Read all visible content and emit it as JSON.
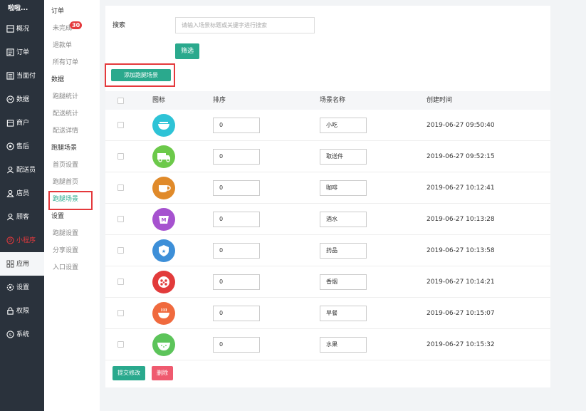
{
  "sidebar": {
    "logo": "啦啦...",
    "items": [
      {
        "label": "概况",
        "icon": "overview-icon"
      },
      {
        "label": "订单",
        "icon": "order-icon"
      },
      {
        "label": "当面付",
        "icon": "pay-icon"
      },
      {
        "label": "数据",
        "icon": "data-icon"
      },
      {
        "label": "商户",
        "icon": "shop-icon"
      },
      {
        "label": "售后",
        "icon": "aftersale-icon"
      },
      {
        "label": "配送员",
        "icon": "courier-icon"
      },
      {
        "label": "店员",
        "icon": "clerk-icon"
      },
      {
        "label": "顾客",
        "icon": "customer-icon"
      },
      {
        "label": "小程序",
        "icon": "miniapp-icon"
      },
      {
        "label": "应用",
        "icon": "apps-icon"
      },
      {
        "label": "设置",
        "icon": "settings-icon"
      },
      {
        "label": "权限",
        "icon": "lock-icon"
      },
      {
        "label": "系统",
        "icon": "system-icon"
      }
    ]
  },
  "subnav": {
    "group_order": "订单",
    "unfinished": "未完成",
    "badge": "30",
    "refund": "退款单",
    "all_orders": "所有订单",
    "group_data": "数据",
    "errand_stats": "跑腿统计",
    "delivery_stats": "配送统计",
    "delivery_detail": "配送详情",
    "group_scene": "跑腿场景",
    "home_settings": "首页设置",
    "errand_home": "跑腿首页",
    "errand_scene": "跑腿场景",
    "group_settings": "设置",
    "errand_settings": "跑腿设置",
    "share_settings": "分享设置",
    "entry_settings": "入口设置"
  },
  "search": {
    "label": "搜索",
    "placeholder": "请输入场景标题或关键字进行搜索",
    "filter_label": "筛选"
  },
  "toolbar": {
    "add_label": "添加跑腿场景"
  },
  "table": {
    "headers": {
      "icon": "图标",
      "sort": "排序",
      "name": "场景名称",
      "created": "创建时间"
    },
    "rows": [
      {
        "sort": "0",
        "name": "小吃",
        "created": "2019-06-27 09:50:40",
        "icon": "snack-bowl-icon",
        "color": "#2ec3d6"
      },
      {
        "sort": "0",
        "name": "取送件",
        "created": "2019-06-27 09:52:15",
        "icon": "delivery-truck-icon",
        "color": "#6cc94a"
      },
      {
        "sort": "0",
        "name": "咖啡",
        "created": "2019-06-27 10:12:41",
        "icon": "coffee-cup-icon",
        "color": "#e08a2a"
      },
      {
        "sort": "0",
        "name": "酒水",
        "created": "2019-06-27 10:13:28",
        "icon": "drink-cup-icon",
        "color": "#a652cf"
      },
      {
        "sort": "0",
        "name": "药品",
        "created": "2019-06-27 10:13:58",
        "icon": "medicine-shield-icon",
        "color": "#3d8fd8"
      },
      {
        "sort": "0",
        "name": "香烟",
        "created": "2019-06-27 10:14:21",
        "icon": "cigarette-icon",
        "color": "#e23b3b"
      },
      {
        "sort": "0",
        "name": "早餐",
        "created": "2019-06-27 10:15:07",
        "icon": "breakfast-bowl-icon",
        "color": "#f06a3e"
      },
      {
        "sort": "0",
        "name": "水果",
        "created": "2019-06-27 10:15:32",
        "icon": "watermelon-icon",
        "color": "#5cc45a"
      }
    ]
  },
  "actions": {
    "submit_label": "提交修改",
    "delete_label": "删除"
  },
  "colors": {
    "accent": "#2aa98d",
    "danger": "#e4393c",
    "sidebar": "#2a323c"
  }
}
